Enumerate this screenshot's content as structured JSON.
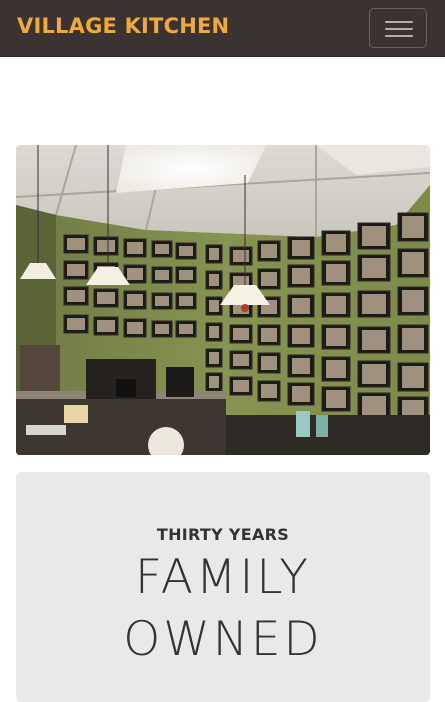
{
  "navbar": {
    "brand": "VILLAGE KITCHEN",
    "menu_icon": "hamburger-menu-icon"
  },
  "hero_photo": {
    "alt": "Restaurant interior wall covered with framed photographs, pendant lamps and a coffee station"
  },
  "feature": {
    "kicker": "THIRTY YEARS",
    "line1": "FAMILY",
    "line2": "OWNED"
  }
}
